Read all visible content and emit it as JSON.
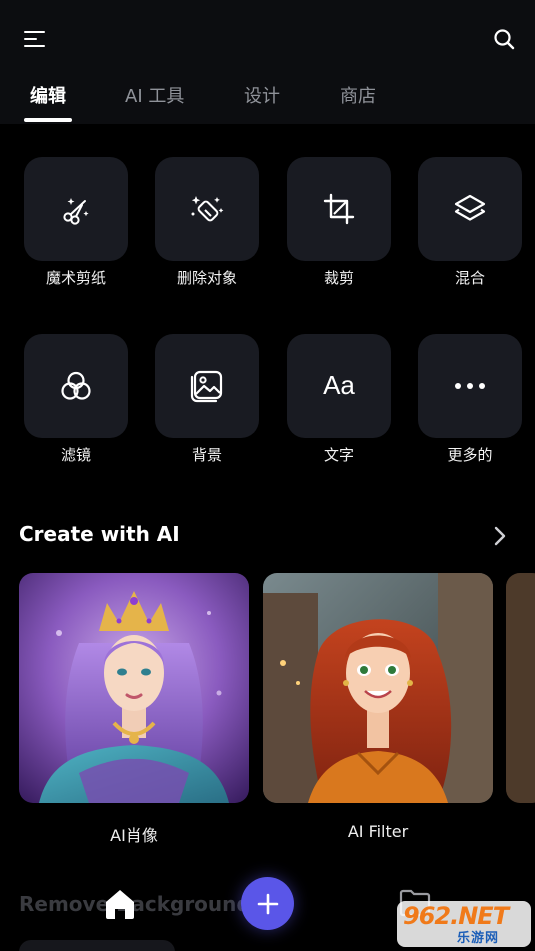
{
  "header": {
    "menu_icon": "menu-icon",
    "search_icon": "search-icon"
  },
  "tabs": [
    {
      "label": "编辑",
      "active": true
    },
    {
      "label": "AI 工具",
      "active": false
    },
    {
      "label": "设计",
      "active": false
    },
    {
      "label": "商店",
      "active": false
    }
  ],
  "tools": [
    {
      "label": "魔术剪纸",
      "icon": "magic-scissors-icon"
    },
    {
      "label": "删除对象",
      "icon": "magic-eraser-icon"
    },
    {
      "label": "裁剪",
      "icon": "crop-icon"
    },
    {
      "label": "混合",
      "icon": "layers-icon"
    },
    {
      "label": "滤镜",
      "icon": "filter-icon"
    },
    {
      "label": "背景",
      "icon": "image-background-icon"
    },
    {
      "label": "文字",
      "icon": "text-icon"
    },
    {
      "label": "更多的",
      "icon": "more-icon"
    }
  ],
  "create_with_ai": {
    "title": "Create with AI",
    "arrow_icon": "chevron-right-icon",
    "cards": [
      {
        "label": "AI肖像",
        "image": "purple-haired-princess-portrait"
      },
      {
        "label": "AI Filter",
        "image": "red-haired-cartoon-woman"
      }
    ]
  },
  "next_section": {
    "title": "Remove Background"
  },
  "bottom_nav": {
    "home_icon": "home-icon",
    "add_icon": "plus-icon",
    "folder_icon": "folder-icon",
    "fab_color": "#5a56e8"
  },
  "watermark": {
    "top": "962.NET",
    "bottom": "乐游网"
  },
  "colors": {
    "background": "#000000",
    "header_bg": "#0c0d10",
    "tile_bg": "#191b22",
    "inactive_tab": "#8f9299",
    "accent": "#5a56e8"
  }
}
